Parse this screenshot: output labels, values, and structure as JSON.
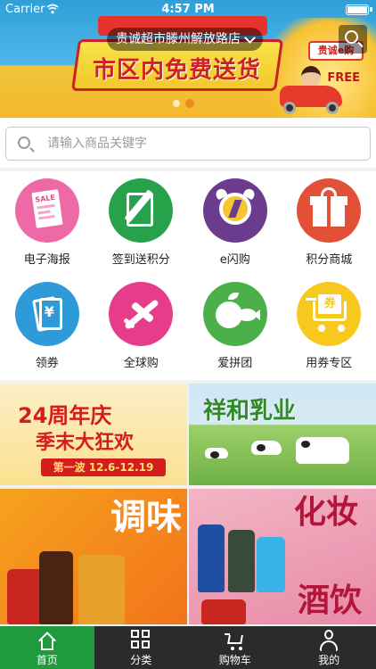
{
  "status_bar": {
    "carrier": "Carrier",
    "time": "4:57 PM"
  },
  "header": {
    "store_name": "贵诚超市滕州解放路店",
    "banner": {
      "slogan": "市区内免费送货",
      "sign_text": "贵诚e购",
      "free_text": "FREE",
      "slide_count": 2,
      "active_slide": 1
    }
  },
  "search": {
    "placeholder": "请输入商品关键字",
    "value": ""
  },
  "categories": [
    {
      "label": "电子海报",
      "icon": "poster-icon",
      "color": "#ee6aa6"
    },
    {
      "label": "签到送积分",
      "icon": "sign-in-icon",
      "color": "#27a24a"
    },
    {
      "label": "e闪购",
      "icon": "alarm-clock-icon",
      "color": "#6b3c8e"
    },
    {
      "label": "积分商城",
      "icon": "gift-icon",
      "color": "#e25137"
    },
    {
      "label": "领券",
      "icon": "coupon-icon",
      "color": "#2f9ad8"
    },
    {
      "label": "全球购",
      "icon": "airplane-icon",
      "color": "#e63c8a"
    },
    {
      "label": "爱拼团",
      "icon": "fruit-fish-icon",
      "color": "#4bb04a"
    },
    {
      "label": "用券专区",
      "icon": "cart-coupon-icon",
      "color": "#f7c91e"
    }
  ],
  "promos": {
    "anniversary": {
      "title": "24周年庆",
      "subtitle": "季末大狂欢",
      "strip": "第一波 12.6-12.19"
    },
    "dairy": {
      "title": "祥和乳业"
    },
    "seasoning": {
      "title": "调味"
    },
    "beauty": {
      "title": "化妆",
      "title2": "酒饮"
    }
  },
  "tabbar": {
    "items": [
      {
        "label": "首页",
        "icon": "home-icon",
        "active": true
      },
      {
        "label": "分类",
        "icon": "category-grid-icon",
        "active": false
      },
      {
        "label": "购物车",
        "icon": "cart-icon",
        "active": false
      },
      {
        "label": "我的",
        "icon": "user-icon",
        "active": false
      }
    ]
  },
  "colors": {
    "active_tab": "#1f9a3d",
    "tabbar": "#2b2b2b",
    "accent_orange": "#f08a1a"
  }
}
